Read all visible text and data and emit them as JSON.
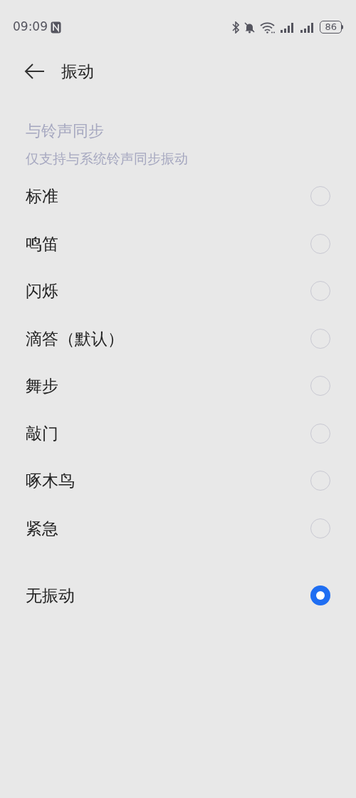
{
  "status_bar": {
    "time": "09:09",
    "battery": "86"
  },
  "header": {
    "title": "振动"
  },
  "sync": {
    "title": "与铃声同步",
    "subtitle": "仅支持与系统铃声同步振动",
    "disabled": true
  },
  "options": [
    {
      "label": "标准",
      "selected": false
    },
    {
      "label": "鸣笛",
      "selected": false
    },
    {
      "label": "闪烁",
      "selected": false
    },
    {
      "label": "滴答（默认）",
      "selected": false
    },
    {
      "label": "舞步",
      "selected": false
    },
    {
      "label": "敲门",
      "selected": false
    },
    {
      "label": "啄木鸟",
      "selected": false
    },
    {
      "label": "紧急",
      "selected": false
    }
  ],
  "none_option": {
    "label": "无振动",
    "selected": true
  }
}
